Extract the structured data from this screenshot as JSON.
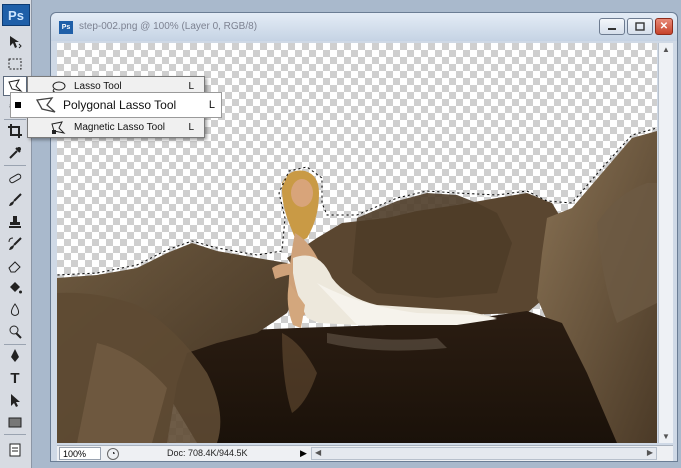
{
  "app": {
    "logo": "Ps"
  },
  "toolbox": {
    "tools": [
      {
        "name": "move-tool",
        "icon": "move-icon",
        "active": false
      },
      {
        "name": "marquee-tool",
        "icon": "marquee-icon",
        "active": false
      },
      {
        "name": "lasso-tool",
        "icon": "polygonal-lasso-icon",
        "active": true
      },
      {
        "name": "quick-selection-tool",
        "icon": "quick-selection-icon",
        "active": false
      },
      {
        "name": "crop-tool",
        "icon": "crop-icon",
        "active": false
      },
      {
        "name": "eyedropper-tool",
        "icon": "eyedropper-icon",
        "active": false
      },
      {
        "name": "healing-tool",
        "icon": "healing-icon",
        "active": false
      },
      {
        "name": "brush-tool",
        "icon": "brush-icon",
        "active": false
      },
      {
        "name": "clone-stamp-tool",
        "icon": "stamp-icon",
        "active": false
      },
      {
        "name": "history-brush-tool",
        "icon": "history-brush-icon",
        "active": false
      },
      {
        "name": "eraser-tool",
        "icon": "eraser-icon",
        "active": false
      },
      {
        "name": "paint-bucket-tool",
        "icon": "bucket-icon",
        "active": false
      },
      {
        "name": "blur-tool",
        "icon": "blur-icon",
        "active": false
      },
      {
        "name": "dodge-tool",
        "icon": "dodge-icon",
        "active": false
      },
      {
        "name": "pen-tool",
        "icon": "pen-icon",
        "active": false
      },
      {
        "name": "type-tool",
        "icon": "type-icon",
        "active": false,
        "glyph": "T"
      },
      {
        "name": "path-selection-tool",
        "icon": "path-select-icon",
        "active": false
      },
      {
        "name": "shape-tool",
        "icon": "rectangle-icon",
        "active": false
      },
      {
        "name": "notes-tool",
        "icon": "notes-icon",
        "active": false
      }
    ]
  },
  "flyout": {
    "items": [
      {
        "label": "Lasso Tool",
        "shortcut": "L",
        "icon": "lasso-icon"
      },
      {
        "label": "Polygonal Lasso Tool",
        "shortcut": "L",
        "icon": "polygonal-lasso-icon",
        "selected": true
      },
      {
        "label": "Magnetic Lasso Tool",
        "shortcut": "L",
        "icon": "magnetic-lasso-icon"
      }
    ]
  },
  "document": {
    "title": "step-002.png @ 100% (Layer 0, RGB/8)",
    "icon_label": "Ps",
    "close_glyph": "✕"
  },
  "statusbar": {
    "zoom": "100%",
    "doc_info": "Doc: 708.4K/944.5K"
  },
  "colors": {
    "toolbox_bg": "#d7dbe2",
    "ps_blue": "#1f5fa8",
    "workspace_bg": "#a9b9cc",
    "close_red": "#c6432b"
  }
}
